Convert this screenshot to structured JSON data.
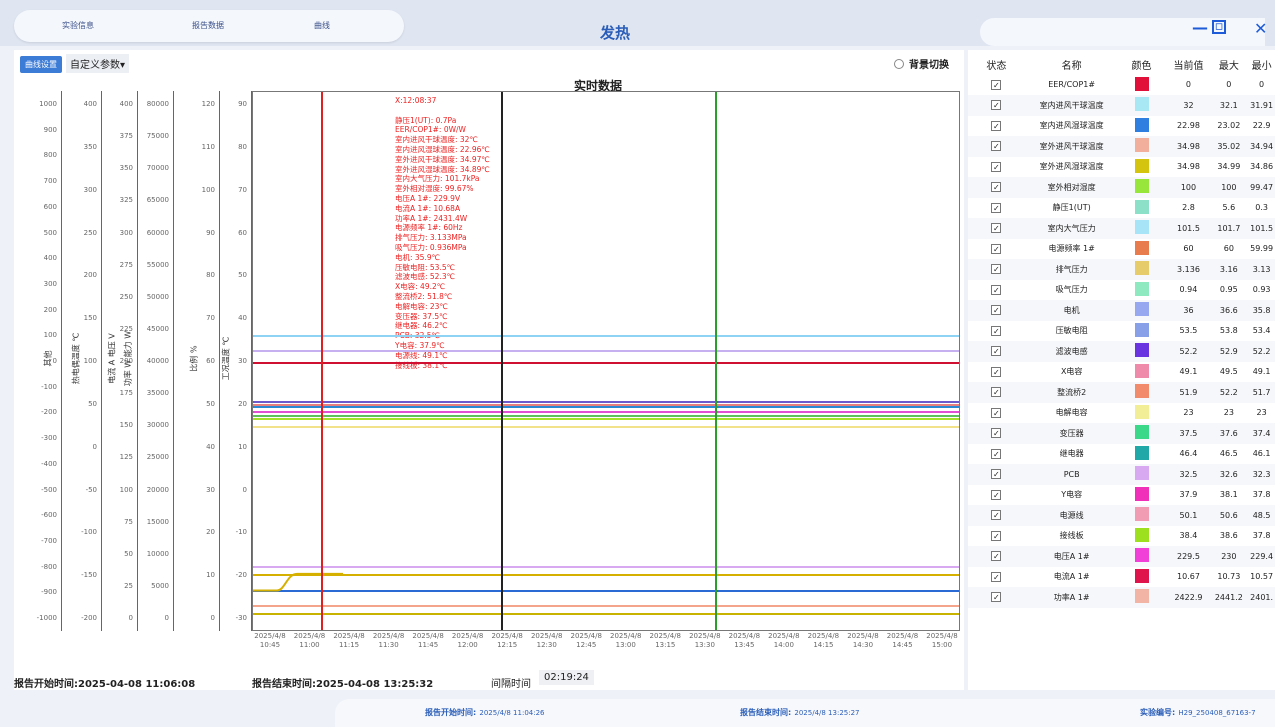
{
  "header": {
    "tabs": [
      "实验信息",
      "报告数据",
      "曲线"
    ],
    "title": "发热",
    "window_controls": [
      "minimize-icon",
      "restore-icon",
      "close-icon"
    ]
  },
  "toolbar": {
    "curve_settings": "曲线设置",
    "custom_params": "自定义参数▾",
    "bg_switch": "背景切换"
  },
  "chart_data": {
    "type": "line",
    "title": "实时数据",
    "x_ticks": [
      "2025/4/8 10:45",
      "2025/4/8 11:00",
      "2025/4/8 11:15",
      "2025/4/8 11:30",
      "2025/4/8 11:45",
      "2025/4/8 12:00",
      "2025/4/8 12:15",
      "2025/4/8 12:30",
      "2025/4/8 12:45",
      "2025/4/8 13:00",
      "2025/4/8 13:15",
      "2025/4/8 13:30",
      "2025/4/8 13:45",
      "2025/4/8 14:00",
      "2025/4/8 14:15",
      "2025/4/8 14:30",
      "2025/4/8 14:45",
      "2025/4/8 15:00"
    ],
    "axes": [
      {
        "label": "其他",
        "ticks": [
          1000,
          900,
          800,
          700,
          600,
          500,
          400,
          300,
          200,
          100,
          0,
          -100,
          -200,
          -300,
          -400,
          -500,
          -600,
          -700,
          -800,
          -900,
          -1000
        ]
      },
      {
        "label": "热电偶温度 ℃",
        "ticks": [
          400,
          350,
          300,
          250,
          200,
          150,
          100,
          50,
          0,
          -50,
          -100,
          -150,
          -200
        ]
      },
      {
        "label": "电流 A 电压 V",
        "ticks": [
          400,
          375,
          350,
          325,
          300,
          275,
          250,
          225,
          200,
          175,
          150,
          125,
          100,
          75,
          50,
          25,
          0
        ]
      },
      {
        "label": "功率 W 能力 W",
        "ticks": [
          80000,
          75000,
          70000,
          65000,
          60000,
          55000,
          50000,
          45000,
          40000,
          35000,
          30000,
          25000,
          20000,
          15000,
          10000,
          5000,
          0
        ]
      },
      {
        "label": "比例 %",
        "ticks": [
          120,
          110,
          100,
          90,
          80,
          70,
          60,
          50,
          40,
          30,
          20,
          10,
          0
        ]
      },
      {
        "label": "工况温度 ℃",
        "ticks": [
          90,
          80,
          70,
          60,
          50,
          40,
          30,
          20,
          10,
          0,
          -10,
          -20,
          -30
        ]
      }
    ],
    "ylim_primary": [
      -35,
      95
    ],
    "cursor_lines": [
      {
        "x": "2025/4/8 11:03",
        "color": "#e02020"
      },
      {
        "x": "2025/4/8 12:08",
        "color": "#222222"
      },
      {
        "x": "2025/4/8 13:25",
        "color": "#2aa02a"
      }
    ],
    "series_levels": [
      {
        "color": "#8fd3f4",
        "y": 36.5
      },
      {
        "color": "#c7b0f0",
        "y": 32.8
      },
      {
        "color": "#d01030",
        "y": 30
      },
      {
        "color": "#6a5acd",
        "y": 20.5
      },
      {
        "color": "#e87f7f",
        "y": 20
      },
      {
        "color": "#2a8ad4",
        "y": 19.3
      },
      {
        "color": "#e04fd4",
        "y": 18.3
      },
      {
        "color": "#5cc15c",
        "y": 17.3
      },
      {
        "color": "#a6e02a",
        "y": 16.6
      },
      {
        "color": "#f2e38a",
        "y": 14.6
      },
      {
        "color": "#d8a9f0",
        "y": -19
      },
      {
        "color": "#d6b000",
        "y": -21
      },
      {
        "color": "#2a6ad4",
        "y": -25
      },
      {
        "color": "#f4a48a",
        "y": -28.5
      },
      {
        "color": "#c8b400",
        "y": -30.5
      }
    ]
  },
  "readout": [
    "X:12:08:37",
    "",
    "静压1(UT): 0.7Pa",
    "EER/COP1#: 0W/W",
    "室内进风干球温度: 32℃",
    "室内进风湿球温度: 22.96℃",
    "室外进风干球温度: 34.97℃",
    "室外进风湿球温度: 34.89℃",
    "室内大气压力: 101.7kPa",
    "室外相对湿度: 99.67%",
    "电压A 1#: 229.9V",
    "电流A 1#: 10.68A",
    "功率A 1#: 2431.4W",
    "电源频率 1#: 60Hz",
    "排气压力: 3.133MPa",
    "吸气压力: 0.936MPa",
    "电机: 35.9℃",
    "压敏电阻: 53.5℃",
    "滤波电感: 52.3℃",
    "X电容: 49.2℃",
    "整流桥2: 51.8℃",
    "电解电容: 23℃",
    "变压器: 37.5℃",
    "继电器: 46.2℃",
    "PCB: 32.5℃",
    "Y电容: 37.9℃",
    "电源线: 49.1℃",
    "接线板: 38.1℃"
  ],
  "footer": {
    "start": "报告开始时间:2025-04-08 11:06:08",
    "end": "报告结束时间:2025-04-08 13:25:32",
    "interval_label": "间隔时间",
    "interval": "02:19:24"
  },
  "bottom": {
    "start_label": "报告开始时间:",
    "start_val": "2025/4/8 11:04:26",
    "end_label": "报告结束时间:",
    "end_val": "2025/4/8 13:25:27",
    "exp_label": "实验编号:",
    "exp_val": "H29_250408_67163-7"
  },
  "legend": {
    "headers": [
      "状态",
      "名称",
      "颜色",
      "当前值",
      "最大",
      "最小"
    ],
    "rows": [
      {
        "name": "EER/COP1#",
        "color": "#e0103a",
        "cur": "0",
        "max": "0",
        "min": "0"
      },
      {
        "name": "室内进风干球温度",
        "color": "#a8e8f4",
        "cur": "32",
        "max": "32.1",
        "min": "31.91"
      },
      {
        "name": "室内进风湿球温度",
        "color": "#2e7fe0",
        "cur": "22.98",
        "max": "23.02",
        "min": "22.9"
      },
      {
        "name": "室外进风干球温度",
        "color": "#f2b09c",
        "cur": "34.98",
        "max": "35.02",
        "min": "34.94"
      },
      {
        "name": "室外进风湿球温度",
        "color": "#d4c410",
        "cur": "34.98",
        "max": "34.99",
        "min": "34.86"
      },
      {
        "name": "室外相对湿度",
        "color": "#98e63c",
        "cur": "100",
        "max": "100",
        "min": "99.47"
      },
      {
        "name": "静压1(UT)",
        "color": "#8ce0c8",
        "cur": "2.8",
        "max": "5.6",
        "min": "0.3"
      },
      {
        "name": "室内大气压力",
        "color": "#a8e4f8",
        "cur": "101.5",
        "max": "101.7",
        "min": "101.5"
      },
      {
        "name": "电源频率 1#",
        "color": "#e87c4c",
        "cur": "60",
        "max": "60",
        "min": "59.99"
      },
      {
        "name": "排气压力",
        "color": "#e6cc6a",
        "cur": "3.136",
        "max": "3.16",
        "min": "3.13"
      },
      {
        "name": "吸气压力",
        "color": "#8ee8c0",
        "cur": "0.94",
        "max": "0.95",
        "min": "0.93"
      },
      {
        "name": "电机",
        "color": "#98a8f0",
        "cur": "36",
        "max": "36.6",
        "min": "35.8"
      },
      {
        "name": "压敏电阻",
        "color": "#88a0e8",
        "cur": "53.5",
        "max": "53.8",
        "min": "53.4"
      },
      {
        "name": "滤波电感",
        "color": "#6a34e0",
        "cur": "52.2",
        "max": "52.9",
        "min": "52.2"
      },
      {
        "name": "X电容",
        "color": "#f08aaa",
        "cur": "49.1",
        "max": "49.5",
        "min": "49.1"
      },
      {
        "name": "整流桥2",
        "color": "#f28a6c",
        "cur": "51.9",
        "max": "52.2",
        "min": "51.7"
      },
      {
        "name": "电解电容",
        "color": "#f2ee98",
        "cur": "23",
        "max": "23",
        "min": "23"
      },
      {
        "name": "变压器",
        "color": "#3cd88a",
        "cur": "37.5",
        "max": "37.6",
        "min": "37.4"
      },
      {
        "name": "继电器",
        "color": "#20a8a8",
        "cur": "46.4",
        "max": "46.5",
        "min": "46.1"
      },
      {
        "name": "PCB",
        "color": "#d8a8f0",
        "cur": "32.5",
        "max": "32.6",
        "min": "32.3"
      },
      {
        "name": "Y电容",
        "color": "#f030b8",
        "cur": "37.9",
        "max": "38.1",
        "min": "37.8"
      },
      {
        "name": "电源线",
        "color": "#f29cb4",
        "cur": "50.1",
        "max": "50.6",
        "min": "48.5"
      },
      {
        "name": "接线板",
        "color": "#9ce020",
        "cur": "38.4",
        "max": "38.6",
        "min": "37.8"
      },
      {
        "name": "电压A 1#",
        "color": "#f040d8",
        "cur": "229.5",
        "max": "230",
        "min": "229.4"
      },
      {
        "name": "电流A 1#",
        "color": "#e0144c",
        "cur": "10.67",
        "max": "10.73",
        "min": "10.57"
      },
      {
        "name": "功率A 1#",
        "color": "#f2b4a4",
        "cur": "2422.9",
        "max": "2441.2",
        "min": "2401."
      }
    ]
  }
}
